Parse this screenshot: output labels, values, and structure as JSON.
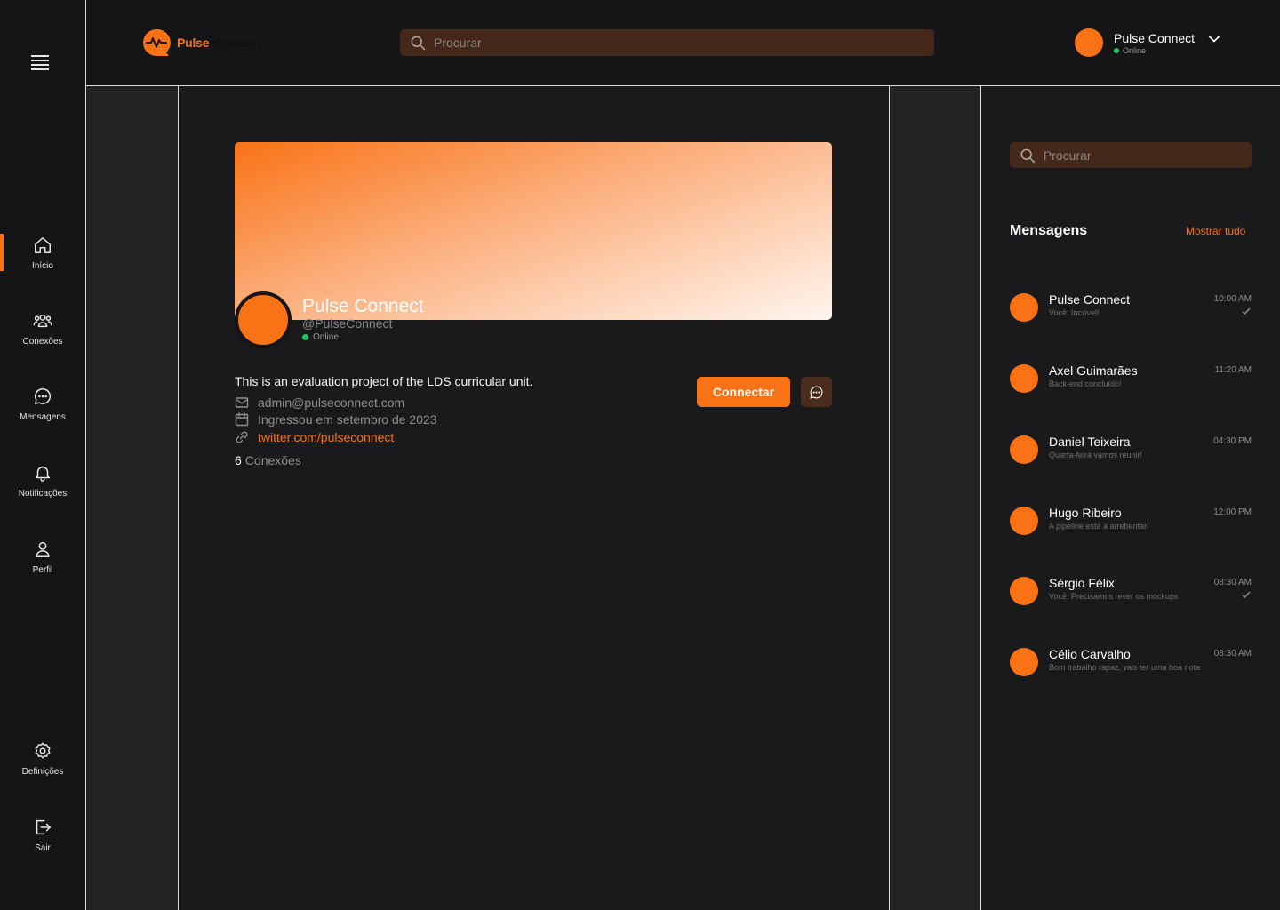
{
  "app": {
    "brand_part1": "Pulse",
    "brand_part2": "Connect",
    "accent_color": "#f97316"
  },
  "header": {
    "search_placeholder": "Procurar",
    "user_name": "Pulse Connect",
    "user_status": "Online"
  },
  "sidebar": {
    "items": [
      {
        "label": "Início",
        "icon": "home-icon"
      },
      {
        "label": "Conexões",
        "icon": "users-icon"
      },
      {
        "label": "Mensagens",
        "icon": "chat-icon"
      },
      {
        "label": "Notificações",
        "icon": "bell-icon"
      },
      {
        "label": "Perfil",
        "icon": "user-icon"
      }
    ],
    "settings_label": "Definições",
    "logout_label": "Sair"
  },
  "profile": {
    "name": "Pulse Connect",
    "handle": "@PulseConnect",
    "status": "Online",
    "bio": "This is an evaluation project of the LDS curricular unit.",
    "email": "admin@pulseconnect.com",
    "joined": "Ingressou em setembro de 2023",
    "link": "twitter.com/pulseconnect",
    "connections_count": "6",
    "connections_label": "Conexões",
    "connect_button": "Connectar"
  },
  "messages_panel": {
    "search_placeholder": "Procurar",
    "title": "Mensagens",
    "show_all": "Mostrar tudo",
    "conversations": [
      {
        "name": "Pulse Connect",
        "preview": "Você: Incrível!",
        "time": "10:00 AM",
        "read": true
      },
      {
        "name": "Axel Guimarães",
        "preview": "Back-end concluído!",
        "time": "11:20 AM",
        "read": false
      },
      {
        "name": "Daniel Teixeira",
        "preview": "Quarta-feira vamos reunir!",
        "time": "04:30 PM",
        "read": false
      },
      {
        "name": "Hugo Ribeiro",
        "preview": "A pipeline está a arrebentar!",
        "time": "12:00 PM",
        "read": false
      },
      {
        "name": "Sérgio Félix",
        "preview": "Você: Precisamos rever os mockups",
        "time": "08:30 AM",
        "read": true
      },
      {
        "name": "Célio Carvalho",
        "preview": "Bom trabalho rapaz, vais ter uma boa nota",
        "time": "08:30 AM",
        "read": false
      }
    ]
  }
}
